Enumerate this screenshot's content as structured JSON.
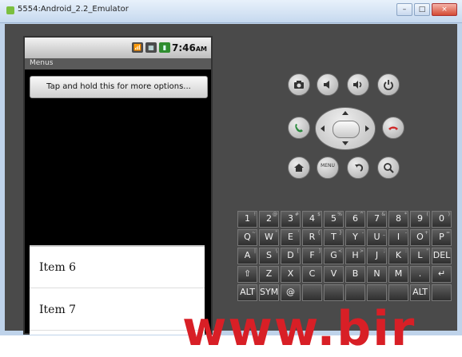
{
  "window": {
    "title": "5554:Android_2.2_Emulator"
  },
  "phone": {
    "status_time": "7:46",
    "status_ampm": "AM",
    "app_title": "Menus",
    "main_button": "Tap and hold this for more options...",
    "menu_items": [
      "Item 6",
      "Item 7"
    ]
  },
  "controls": {
    "menu_button": "MENU"
  },
  "keyboard": {
    "rows": [
      [
        {
          "k": "1",
          "s": "!"
        },
        {
          "k": "2",
          "s": "@"
        },
        {
          "k": "3",
          "s": "#"
        },
        {
          "k": "4",
          "s": "$"
        },
        {
          "k": "5",
          "s": "%"
        },
        {
          "k": "6",
          "s": "^"
        },
        {
          "k": "7",
          "s": "&"
        },
        {
          "k": "8",
          "s": "*"
        },
        {
          "k": "9",
          "s": "("
        },
        {
          "k": "0",
          "s": ")"
        }
      ],
      [
        {
          "k": "Q",
          "s": "~"
        },
        {
          "k": "W",
          "s": "\""
        },
        {
          "k": "E",
          "s": "'"
        },
        {
          "k": "R",
          "s": "{"
        },
        {
          "k": "T",
          "s": "}"
        },
        {
          "k": "Y",
          "s": "-"
        },
        {
          "k": "U",
          "s": "_"
        },
        {
          "k": "I",
          "s": "-"
        },
        {
          "k": "O",
          "s": "+"
        },
        {
          "k": "P",
          "s": "="
        }
      ],
      [
        {
          "k": "A",
          "s": "|"
        },
        {
          "k": "S",
          "s": "\\"
        },
        {
          "k": "D",
          "s": "["
        },
        {
          "k": "F",
          "s": "]"
        },
        {
          "k": "G",
          "s": "<"
        },
        {
          "k": "H",
          "s": ">"
        },
        {
          "k": "J",
          "s": ";"
        },
        {
          "k": "K",
          "s": ":"
        },
        {
          "k": "L",
          "s": "\""
        },
        {
          "k": "DEL",
          "s": ""
        }
      ],
      [
        {
          "k": "⇧",
          "s": ""
        },
        {
          "k": "Z",
          "s": ""
        },
        {
          "k": "X",
          "s": ""
        },
        {
          "k": "C",
          "s": ""
        },
        {
          "k": "V",
          "s": ""
        },
        {
          "k": "B",
          "s": ""
        },
        {
          "k": "N",
          "s": ""
        },
        {
          "k": "M",
          "s": ""
        },
        {
          "k": ".",
          "s": ""
        },
        {
          "k": "↵",
          "s": ""
        }
      ],
      [
        {
          "k": "ALT",
          "s": ""
        },
        {
          "k": "SYM",
          "s": ""
        },
        {
          "k": "@",
          "s": ""
        },
        {
          "k": "",
          "s": ""
        },
        {
          "k": "",
          "s": ""
        },
        {
          "k": "",
          "s": ""
        },
        {
          "k": "",
          "s": ""
        },
        {
          "k": "",
          "s": ""
        },
        {
          "k": "ALT",
          "s": ""
        },
        {
          "k": "",
          "s": ""
        }
      ]
    ]
  },
  "overlay": {
    "watermark": "www.bir"
  }
}
